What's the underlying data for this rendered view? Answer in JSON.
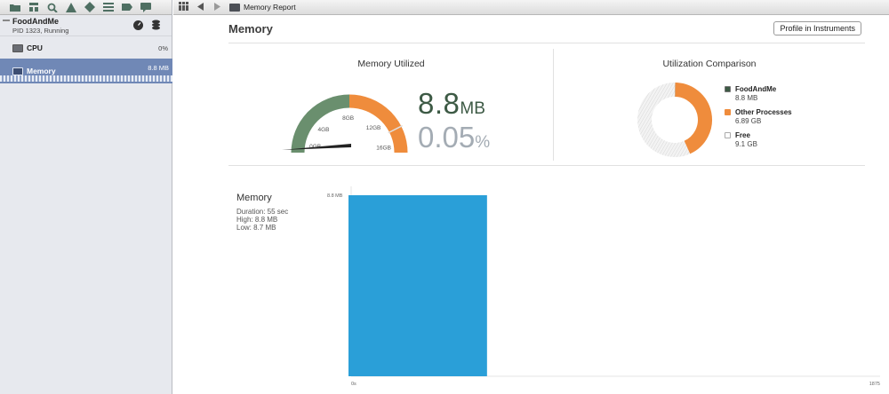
{
  "sidebar": {
    "process": {
      "name": "FoodAndMe",
      "status": "PID 1323, Running"
    },
    "gauges": [
      {
        "label": "CPU",
        "value": "0%"
      },
      {
        "label": "Memory",
        "value": "8.8 MB"
      }
    ]
  },
  "jump_bar": {
    "current": "Memory Report"
  },
  "report": {
    "title": "Memory",
    "profile_button": "Profile in Instruments",
    "utilized": {
      "title": "Memory Utilized",
      "value": "8.8",
      "value_unit": "MB",
      "percent": "0.05",
      "percent_unit": "%",
      "ticks": [
        "0GB",
        "4GB",
        "8GB",
        "12GB",
        "16GB"
      ]
    },
    "comparison": {
      "title": "Utilization Comparison",
      "legend": [
        {
          "name": "FoodAndMe",
          "value": "8.8 MB"
        },
        {
          "name": "Other Processes",
          "value": "6.89 GB"
        },
        {
          "name": "Free",
          "value": "9.1 GB"
        }
      ]
    },
    "memory_chart": {
      "title": "Memory",
      "duration": "Duration: 55 sec",
      "high": "High: 8.8 MB",
      "low": "Low: 8.7 MB"
    }
  },
  "colors": {
    "accent": "#7088b6",
    "gauge_green": "#6a8f6e",
    "gauge_orange": "#ef8c3c",
    "bar_blue": "#2a9fd8"
  },
  "chart_data": [
    {
      "type": "pie",
      "labels": [
        "FoodAndMe",
        "Other Processes",
        "Free"
      ],
      "values": [
        0.0088,
        6.89,
        9.1
      ],
      "unit": "GB"
    },
    {
      "type": "bar",
      "x": [
        0,
        55
      ],
      "values": [
        8.8
      ],
      "y_tick_label": "8.8 MB",
      "x_tick_labels": [
        "0s",
        "1875"
      ],
      "ylim": [
        0,
        8.8
      ]
    }
  ]
}
